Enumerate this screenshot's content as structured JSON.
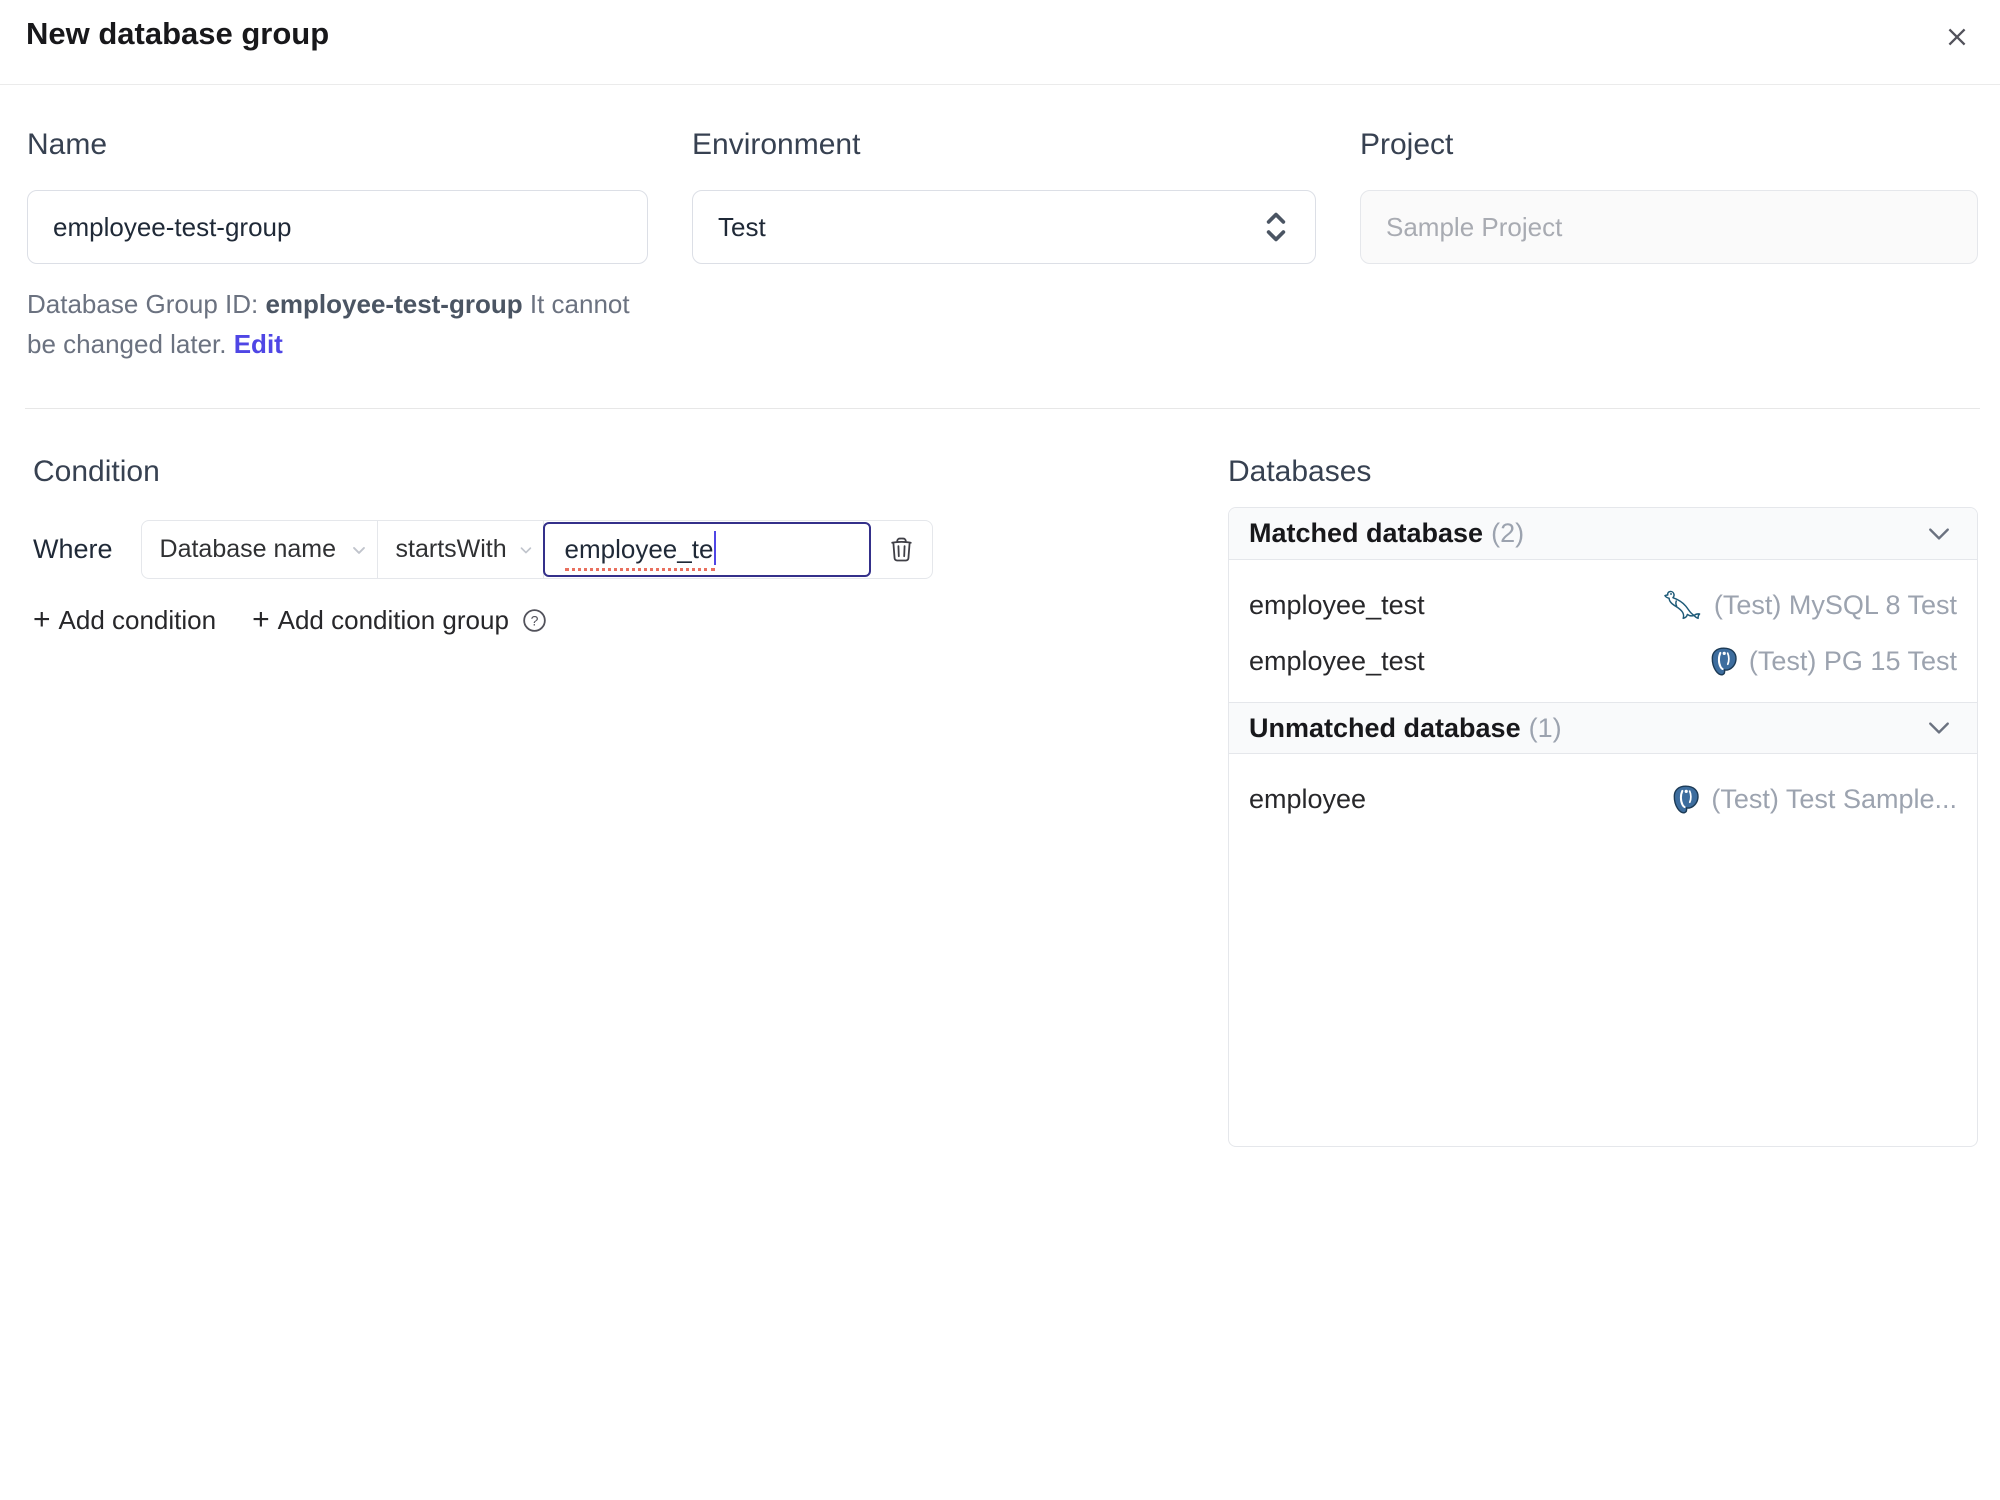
{
  "dialog": {
    "title": "New database group"
  },
  "form": {
    "name": {
      "label": "Name",
      "value": "employee-test-group"
    },
    "environment": {
      "label": "Environment",
      "value": "Test"
    },
    "project": {
      "label": "Project",
      "value": "Sample Project"
    },
    "group_id_hint": {
      "prefix": "Database Group ID: ",
      "id": "employee-test-group",
      "suffix": " It cannot be changed later. ",
      "edit_link": "Edit"
    }
  },
  "condition": {
    "heading": "Condition",
    "where_label": "Where",
    "factor": "Database name",
    "operator": "startsWith",
    "value": "employee_te",
    "plus": "+",
    "add_condition": "Add condition",
    "add_condition_group": "Add condition group"
  },
  "databases": {
    "heading": "Databases",
    "matched": {
      "title": "Matched database",
      "count": "(2)",
      "rows": [
        {
          "name": "employee_test",
          "instance": "(Test) MySQL 8 Test",
          "engine": "mysql"
        },
        {
          "name": "employee_test",
          "instance": "(Test) PG 15 Test",
          "engine": "postgres"
        }
      ]
    },
    "unmatched": {
      "title": "Unmatched database",
      "count": "(1)",
      "rows": [
        {
          "name": "employee",
          "instance": "(Test) Test Sample...",
          "engine": "postgres"
        }
      ]
    }
  },
  "colors": {
    "accent": "#4f46e5",
    "focus_border": "#34308a",
    "postgres_blue": "#336791",
    "mysql_teal": "#19647e"
  }
}
